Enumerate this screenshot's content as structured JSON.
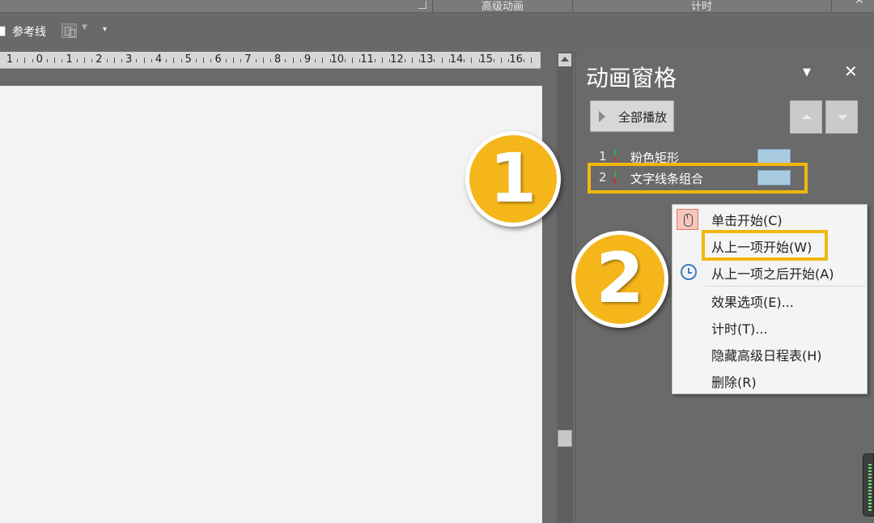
{
  "ribbon": {
    "groups": [
      "高级动画",
      "计时"
    ],
    "guides_label": "参考线"
  },
  "ruler": {
    "numbers": [
      "1",
      "0",
      "1",
      "2",
      "3",
      "4",
      "5",
      "6",
      "7",
      "8",
      "9",
      "10",
      "11",
      "12",
      "13",
      "14",
      "15",
      "16"
    ]
  },
  "pane": {
    "title": "动画窗格",
    "play_all_label": "全部播放",
    "items": [
      {
        "number": "1",
        "name": "粉色矩形"
      },
      {
        "number": "2",
        "name": "文字线条组合"
      }
    ]
  },
  "callouts": [
    "1",
    "2"
  ],
  "context_menu": {
    "items": [
      "单击开始(C)",
      "从上一项开始(W)",
      "从上一项之后开始(A)",
      "效果选项(E)...",
      "计时(T)...",
      "隐藏高级日程表(H)",
      "删除(R)"
    ]
  },
  "colors": {
    "highlight": "#f0b70d",
    "badge": "#f4b61b",
    "timeline_bar": "#a9cbe2"
  }
}
